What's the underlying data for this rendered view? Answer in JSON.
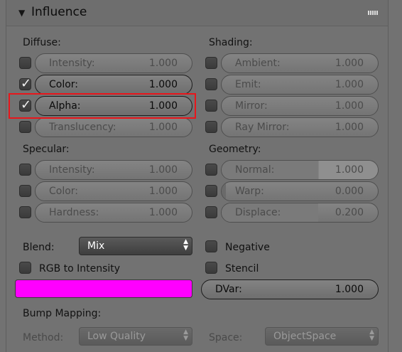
{
  "header": {
    "title": "Influence",
    "collapse_icon": "triangle-down-icon",
    "drag_icon": "drag-handle-icon"
  },
  "diffuse": {
    "heading": "Diffuse:",
    "rows": [
      {
        "label": "Intensity:",
        "value": "1.000",
        "checked": false,
        "active": false
      },
      {
        "label": "Color:",
        "value": "1.000",
        "checked": true,
        "active": true
      },
      {
        "label": "Alpha:",
        "value": "1.000",
        "checked": true,
        "active": true,
        "highlighted": true
      },
      {
        "label": "Translucency:",
        "value": "1.000",
        "checked": false,
        "active": false
      }
    ]
  },
  "shading": {
    "heading": "Shading:",
    "rows": [
      {
        "label": "Ambient:",
        "value": "1.000",
        "checked": false
      },
      {
        "label": "Emit:",
        "value": "1.000",
        "checked": false
      },
      {
        "label": "Mirror:",
        "value": "1.000",
        "checked": false
      },
      {
        "label": "Ray Mirror:",
        "value": "1.000",
        "checked": false
      }
    ]
  },
  "specular": {
    "heading": "Specular:",
    "rows": [
      {
        "label": "Intensity:",
        "value": "1.000",
        "checked": false
      },
      {
        "label": "Color:",
        "value": "1.000",
        "checked": false
      },
      {
        "label": "Hardness:",
        "value": "1.000",
        "checked": false
      }
    ]
  },
  "geometry": {
    "heading": "Geometry:",
    "rows": [
      {
        "label": "Normal:",
        "value": "1.000",
        "checked": false,
        "fill": 1.0
      },
      {
        "label": "Warp:",
        "value": "0.000",
        "checked": false,
        "fill": 0.0
      },
      {
        "label": "Displace:",
        "value": "0.200",
        "checked": false,
        "fill": 0.2
      }
    ]
  },
  "blend": {
    "label": "Blend:",
    "value": "Mix"
  },
  "negative": {
    "label": "Negative",
    "checked": false
  },
  "rgb_to_intensity": {
    "label": "RGB to Intensity",
    "checked": false
  },
  "stencil": {
    "label": "Stencil",
    "checked": false
  },
  "color_swatch": {
    "color": "#ff00ff"
  },
  "dvar": {
    "label": "DVar:",
    "value": "1.000"
  },
  "bump_mapping": {
    "heading": "Bump Mapping:",
    "method_label": "Method:",
    "method_value": "Low Quality",
    "space_label": "Space:",
    "space_value": "ObjectSpace"
  },
  "colors": {
    "highlight": "#e8161b",
    "panel": "#727272"
  }
}
